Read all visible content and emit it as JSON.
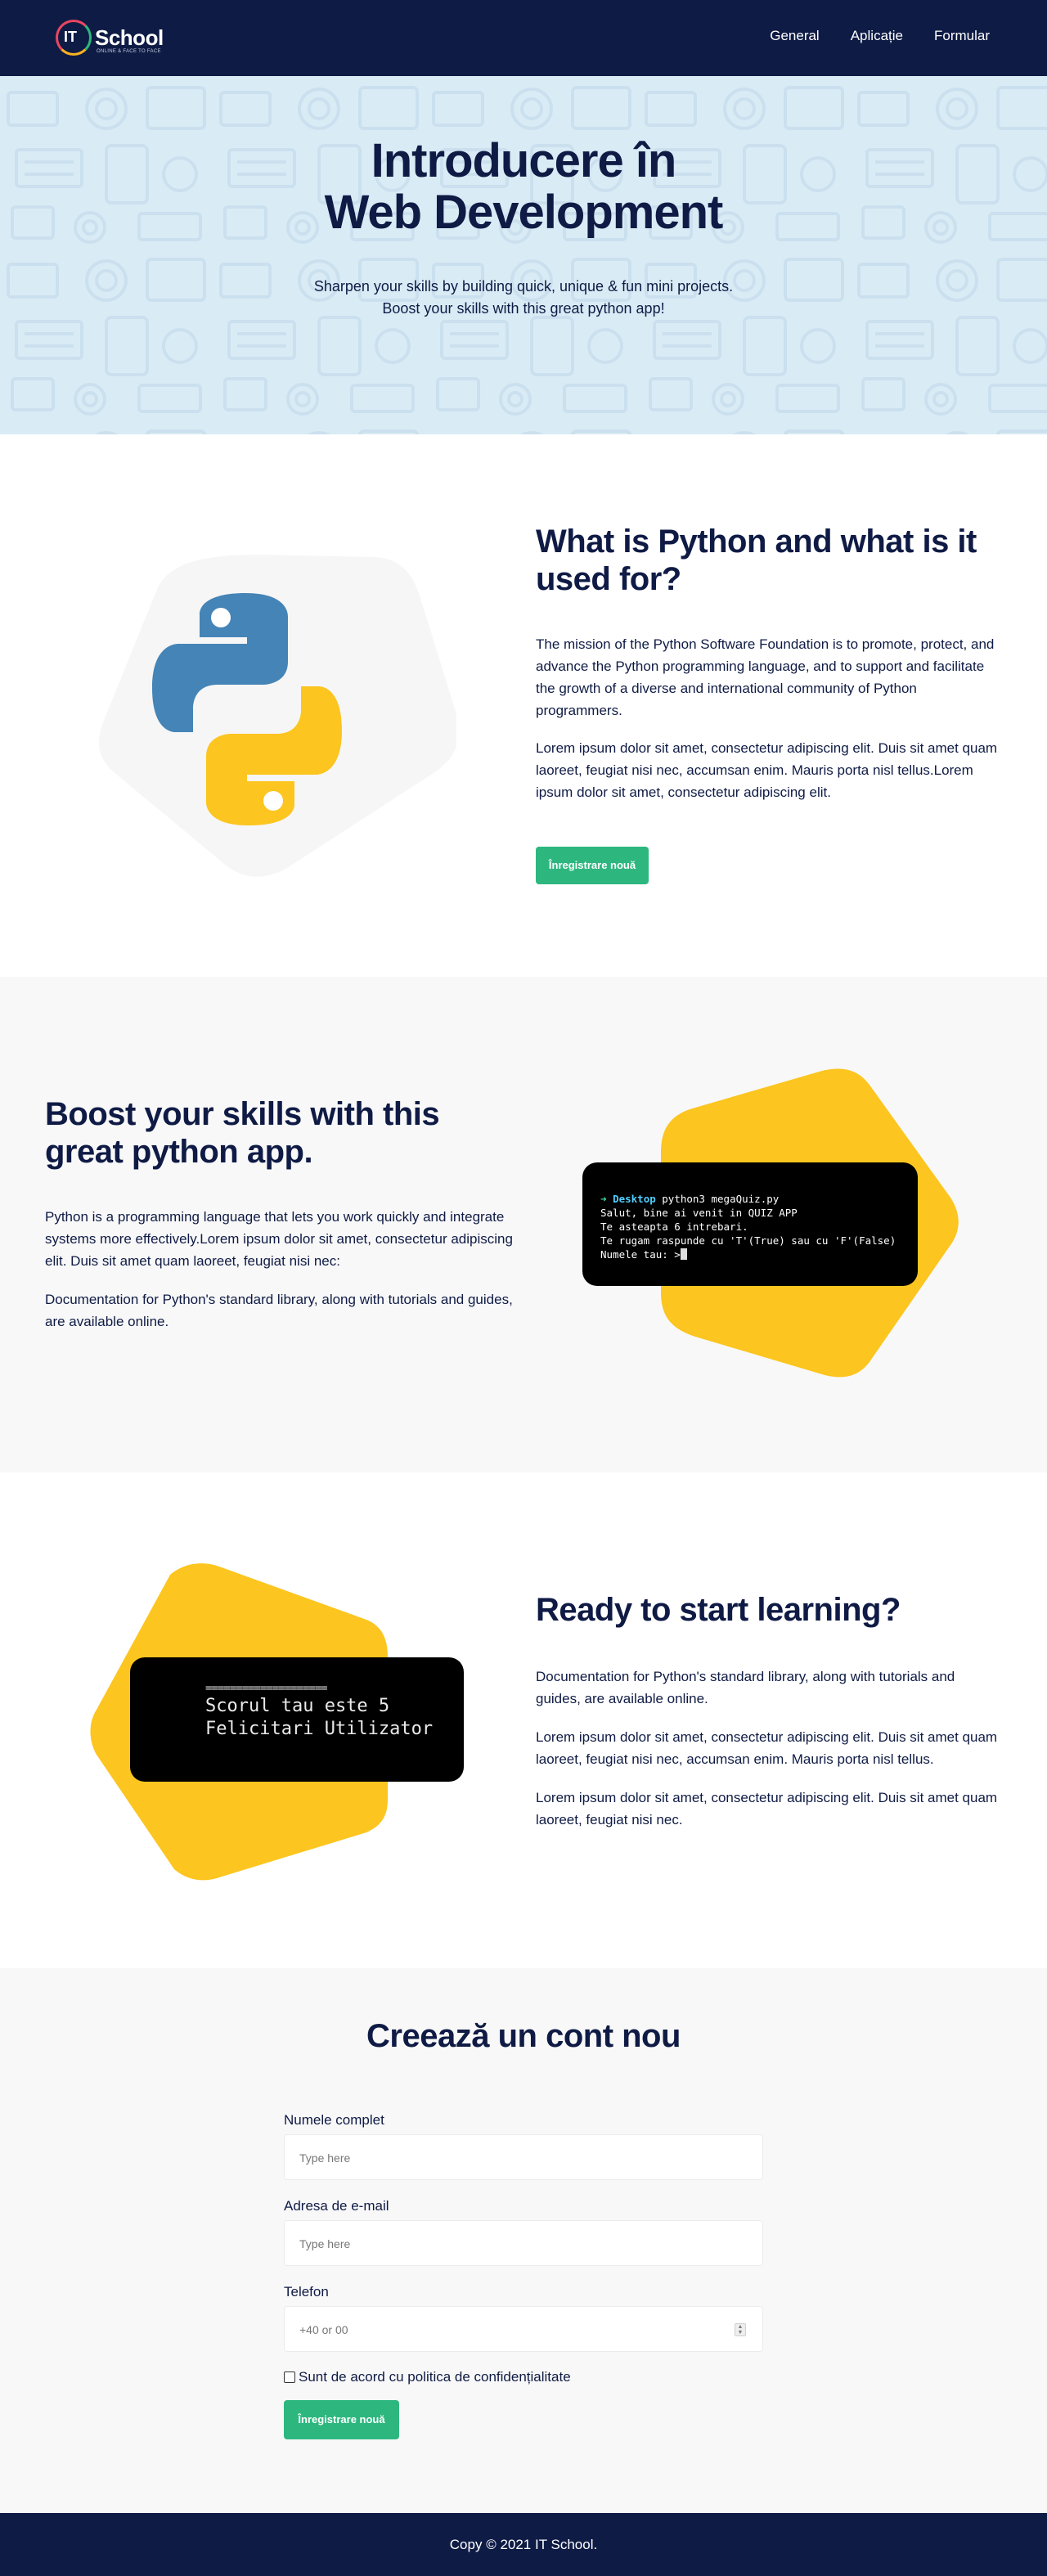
{
  "header": {
    "logo": {
      "it": "IT",
      "school": "School",
      "tagline": "ONLINE & FACE TO FACE"
    },
    "nav": [
      "General",
      "Aplicație",
      "Formular"
    ]
  },
  "hero": {
    "title_line1": "Introducere în",
    "title_line2": "Web Development",
    "subtitle_line1": "Sharpen your skills by building quick, unique & fun mini projects.",
    "subtitle_line2": "Boost your skills with this great python app!"
  },
  "section_python": {
    "heading": "What is Python and what is it used for?",
    "paragraph1": "The mission of the Python Software Foundation is to promote, protect, and advance the Python programming language, and to support and facilitate the growth of a diverse and international community of Python programmers.",
    "paragraph2": "Lorem ipsum dolor sit amet, consectetur adipiscing elit. Duis sit amet quam laoreet, feugiat nisi nec, accumsan enim. Mauris porta nisl tellus.Lorem ipsum dolor sit amet, consectetur adipiscing elit.",
    "button": "Înregistrare nouă",
    "logo_icon": "python-logo-icon"
  },
  "section_boost": {
    "heading": "Boost your skills with this great python app.",
    "paragraph1": "Python is a programming language that lets you work quickly and integrate systems more effectively.Lorem ipsum dolor sit amet, consectetur adipiscing elit. Duis sit amet quam laoreet, feugiat nisi nec:",
    "paragraph2": "Documentation for Python's standard library, along with tutorials and guides, are available online.",
    "terminal": {
      "arrow": "➜",
      "dir": "Desktop",
      "command": "python3 megaQuiz.py",
      "line1": "Salut, bine ai venit in QUIZ APP",
      "line2": "Te asteapta 6 intrebari.",
      "line3": "Te rugam raspunde cu 'T'(True) sau cu 'F'(False)",
      "prompt": "Numele tau: >"
    }
  },
  "section_ready": {
    "heading": "Ready to start learning?",
    "paragraph1": "Documentation for Python's standard library, along with tutorials and guides, are available online.",
    "paragraph2": "Lorem ipsum dolor sit amet, consectetur adipiscing elit. Duis sit amet quam laoreet, feugiat nisi nec, accumsan enim. Mauris porta nisl tellus.",
    "paragraph3": "Lorem ipsum dolor sit amet, consectetur adipiscing elit. Duis sit amet quam laoreet, feugiat nisi nec.",
    "terminal": {
      "rule": "====================",
      "line1": "Scorul tau este 5",
      "line2": "Felicitari Utilizator"
    }
  },
  "form": {
    "heading": "Creează un cont nou",
    "name_label": "Numele complet",
    "name_placeholder": "Type here",
    "email_label": "Adresa de e-mail",
    "email_placeholder": "Type here",
    "phone_label": "Telefon",
    "phone_placeholder": "+40 or 00",
    "consent": "Sunt de acord cu politica de confidențialitate",
    "submit": "Înregistrare nouă"
  },
  "footer": {
    "copy": "Copy © 2021 IT School."
  },
  "colors": {
    "navy": "#0e1b45",
    "hero_bg": "#d9ebf5",
    "accent_green": "#2db77f",
    "accent_yellow": "#fcc51f",
    "python_blue": "#3f7ab6",
    "python_yellow": "#fcc51f"
  }
}
